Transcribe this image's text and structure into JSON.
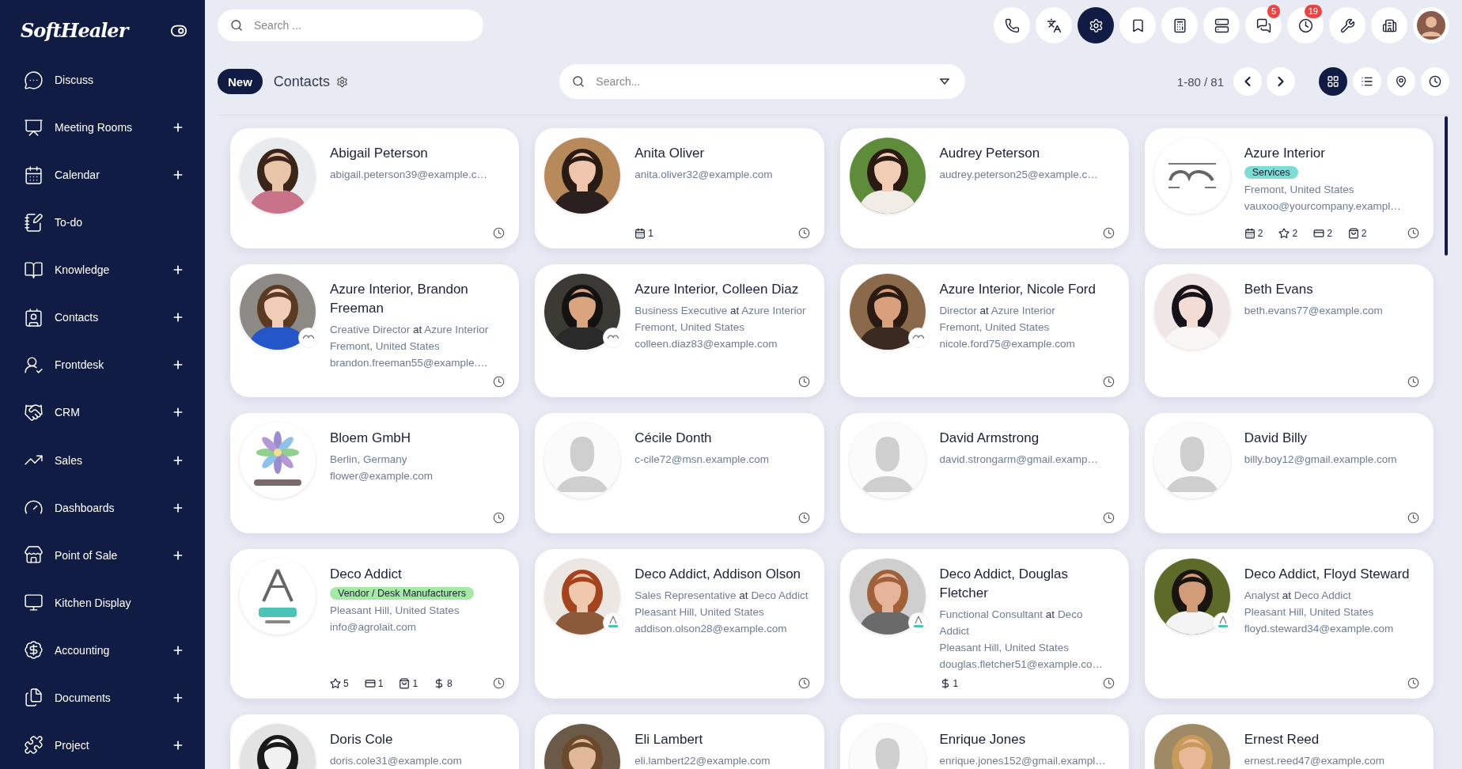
{
  "sidebar": {
    "brand": "SoftHealer",
    "items": [
      {
        "label": "Discuss",
        "kind": "discuss",
        "expandable": false
      },
      {
        "label": "Meeting Rooms",
        "kind": "meeting",
        "expandable": true
      },
      {
        "label": "Calendar",
        "kind": "calendar",
        "expandable": true
      },
      {
        "label": "To-do",
        "kind": "todo",
        "expandable": false
      },
      {
        "label": "Knowledge",
        "kind": "knowledge",
        "expandable": true
      },
      {
        "label": "Contacts",
        "kind": "contacts",
        "expandable": true
      },
      {
        "label": "Frontdesk",
        "kind": "frontdesk",
        "expandable": true
      },
      {
        "label": "CRM",
        "kind": "crm",
        "expandable": true
      },
      {
        "label": "Sales",
        "kind": "sales",
        "expandable": true
      },
      {
        "label": "Dashboards",
        "kind": "dashboards",
        "expandable": true
      },
      {
        "label": "Point of Sale",
        "kind": "pos",
        "expandable": true
      },
      {
        "label": "Kitchen Display",
        "kind": "kitchen",
        "expandable": false
      },
      {
        "label": "Accounting",
        "kind": "accounting",
        "expandable": true
      },
      {
        "label": "Documents",
        "kind": "documents",
        "expandable": true
      },
      {
        "label": "Project",
        "kind": "project",
        "expandable": true
      }
    ]
  },
  "top_bar": {
    "search": {
      "placeholder": "Search ..."
    },
    "icons": [
      {
        "kind": "phone",
        "selected": false
      },
      {
        "kind": "translate",
        "selected": false
      },
      {
        "kind": "settings",
        "selected": true
      },
      {
        "kind": "bookmark",
        "selected": false
      },
      {
        "kind": "calculator",
        "selected": false
      },
      {
        "kind": "server",
        "selected": false
      },
      {
        "kind": "chat",
        "selected": false,
        "badge": "5"
      },
      {
        "kind": "clock",
        "selected": false,
        "badge": "19"
      },
      {
        "kind": "tools",
        "selected": false
      },
      {
        "kind": "building",
        "selected": false
      },
      {
        "kind": "avatar",
        "selected": false
      }
    ]
  },
  "control_panel": {
    "new_button": "New",
    "title": "Contacts",
    "search": {
      "placeholder": "Search..."
    },
    "pager": "1-80 / 81",
    "views": [
      {
        "kind": "kanban",
        "selected": true
      },
      {
        "kind": "list",
        "selected": false
      },
      {
        "kind": "map",
        "selected": false
      },
      {
        "kind": "activity",
        "selected": false
      }
    ]
  },
  "cards": [
    {
      "name": "Abigail Peterson",
      "activity": true,
      "email": "abigail.peterson39@example.c…"
    },
    {
      "name": "Anita Oliver",
      "activity": true,
      "email": "anita.oliver32@example.com",
      "stats": [
        {
          "kind": "calendar",
          "count": "1"
        }
      ]
    },
    {
      "name": "Audrey Peterson",
      "activity": true,
      "email": "audrey.peterson25@example.c…"
    },
    {
      "name": "Azure Interior",
      "activity": true,
      "avatar": {
        "kind": "logo"
      },
      "tag": {
        "label": "Services",
        "color": "#7fdcd2"
      },
      "location": "Fremont, United States",
      "email": "vauxoo@yourcompany.exampl…",
      "stats": [
        {
          "kind": "calendar",
          "count": "2"
        },
        {
          "kind": "star",
          "count": "2"
        },
        {
          "kind": "card",
          "count": "2"
        },
        {
          "kind": "bag",
          "count": "2"
        }
      ]
    },
    {
      "name": "Azure Interior, Brandon Freeman",
      "activity": true,
      "company_badge": true,
      "job": {
        "title": "Creative Director",
        "at": "at",
        "company": "Azure Interior"
      },
      "location": "Fremont, United States",
      "email": "brandon.freeman55@example.…"
    },
    {
      "name": "Azure Interior, Colleen Diaz",
      "activity": true,
      "company_badge": true,
      "job": {
        "title": "Business Executive",
        "at": "at",
        "company": "Azure Interior"
      },
      "location": "Fremont, United States",
      "email": "colleen.diaz83@example.com"
    },
    {
      "name": "Azure Interior, Nicole Ford",
      "activity": true,
      "company_badge": true,
      "job": {
        "title": "Director",
        "at": "at",
        "company": "Azure Interior"
      },
      "location": "Fremont, United States",
      "email": "nicole.ford75@example.com"
    },
    {
      "name": "Beth Evans",
      "activity": true,
      "email": "beth.evans77@example.com"
    },
    {
      "name": "Bloem GmbH",
      "activity": true,
      "avatar": {
        "kind": "logo"
      },
      "location": "Berlin, Germany",
      "email": "flower@example.com"
    },
    {
      "name": "Cécile Donth",
      "activity": true,
      "avatar": {
        "kind": "placeholder"
      },
      "email": "c-cile72@msn.example.com"
    },
    {
      "name": "David Armstrong",
      "activity": true,
      "avatar": {
        "kind": "placeholder"
      },
      "email": "david.strongarm@gmail.examp…"
    },
    {
      "name": "David Billy",
      "activity": true,
      "avatar": {
        "kind": "placeholder"
      },
      "email": "billy.boy12@gmail.example.com"
    },
    {
      "name": "Deco Addict",
      "activity": true,
      "avatar": {
        "kind": "logo"
      },
      "tag": {
        "label": "Vendor / Desk Manufacturers",
        "color": "#a6e9a6"
      },
      "location": "Pleasant Hill, United States",
      "email": "info@agrolait.com",
      "stats": [
        {
          "kind": "star",
          "count": "5"
        },
        {
          "kind": "card",
          "count": "1"
        },
        {
          "kind": "bag",
          "count": "1"
        },
        {
          "kind": "dollar",
          "count": "8"
        }
      ]
    },
    {
      "name": "Deco Addict, Addison Olson",
      "activity": true,
      "company_badge": true,
      "job": {
        "title": "Sales Representative",
        "at": "at",
        "company": "Deco Addict"
      },
      "location": "Pleasant Hill, United States",
      "email": "addison.olson28@example.com"
    },
    {
      "name": "Deco Addict, Douglas Fletcher",
      "activity": true,
      "company_badge": true,
      "job": {
        "title": "Functional Consultant",
        "at": "at",
        "company": "Deco Addict"
      },
      "location": "Pleasant Hill, United States",
      "email": "douglas.fletcher51@example.co…",
      "stats": [
        {
          "kind": "dollar",
          "count": "1"
        }
      ]
    },
    {
      "name": "Deco Addict, Floyd Steward",
      "activity": true,
      "company_badge": true,
      "job": {
        "title": "Analyst",
        "at": "at",
        "company": "Deco Addict"
      },
      "location": "Pleasant Hill, United States",
      "email": "floyd.steward34@example.com"
    },
    {
      "name": "Doris Cole",
      "email": "doris.cole31@example.com"
    },
    {
      "name": "Eli Lambert",
      "email": "eli.lambert22@example.com"
    },
    {
      "name": "Enrique Jones",
      "avatar": {
        "kind": "placeholder"
      },
      "email": "enrique.jones152@gmail.exampl…"
    },
    {
      "name": "Ernest Reed",
      "email": "ernest.reed47@example.com"
    }
  ]
}
